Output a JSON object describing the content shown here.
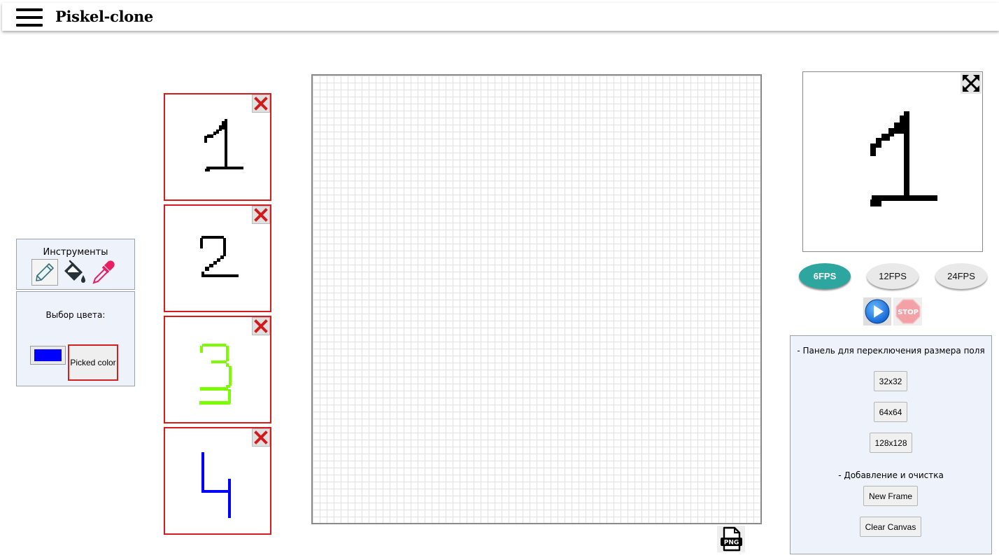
{
  "header": {
    "title": "Piskel-clone"
  },
  "tools": {
    "title": "Инструменты",
    "items": [
      {
        "icon": "pencil-icon"
      },
      {
        "icon": "paint-bucket-icon"
      },
      {
        "icon": "eyedropper-icon"
      }
    ]
  },
  "color": {
    "title": "Выбор цвета:",
    "current": "#0000ff",
    "picked_label": "Picked color"
  },
  "frames": [
    {
      "content": "1",
      "color": "#000000"
    },
    {
      "content": "2",
      "color": "#000000"
    },
    {
      "content": "3",
      "color": "#7cfc00"
    },
    {
      "content": "4",
      "color": "#0000ff"
    }
  ],
  "canvas": {
    "export_icon": "png-export-icon"
  },
  "preview": {
    "content": "1",
    "color": "#000000",
    "fullscreen_icon": "fullscreen-icon"
  },
  "fps": {
    "options": [
      "6FPS",
      "12FPS",
      "24FPS"
    ],
    "selected": "6FPS"
  },
  "playback": {
    "play_icon": "play-icon",
    "stop_label": "STOP"
  },
  "size_panel": {
    "title": "- Панель для переключения размера поля",
    "sizes": [
      "32x32",
      "64x64",
      "128x128"
    ],
    "add_title": "- Добавление и очистка",
    "new_frame_label": "New Frame",
    "clear_canvas_label": "Clear Canvas"
  },
  "accent_colors": {
    "frame_border": "#d61c1c",
    "fps_active": "#2ea6a0",
    "panel_bg": "#eef3fb"
  }
}
